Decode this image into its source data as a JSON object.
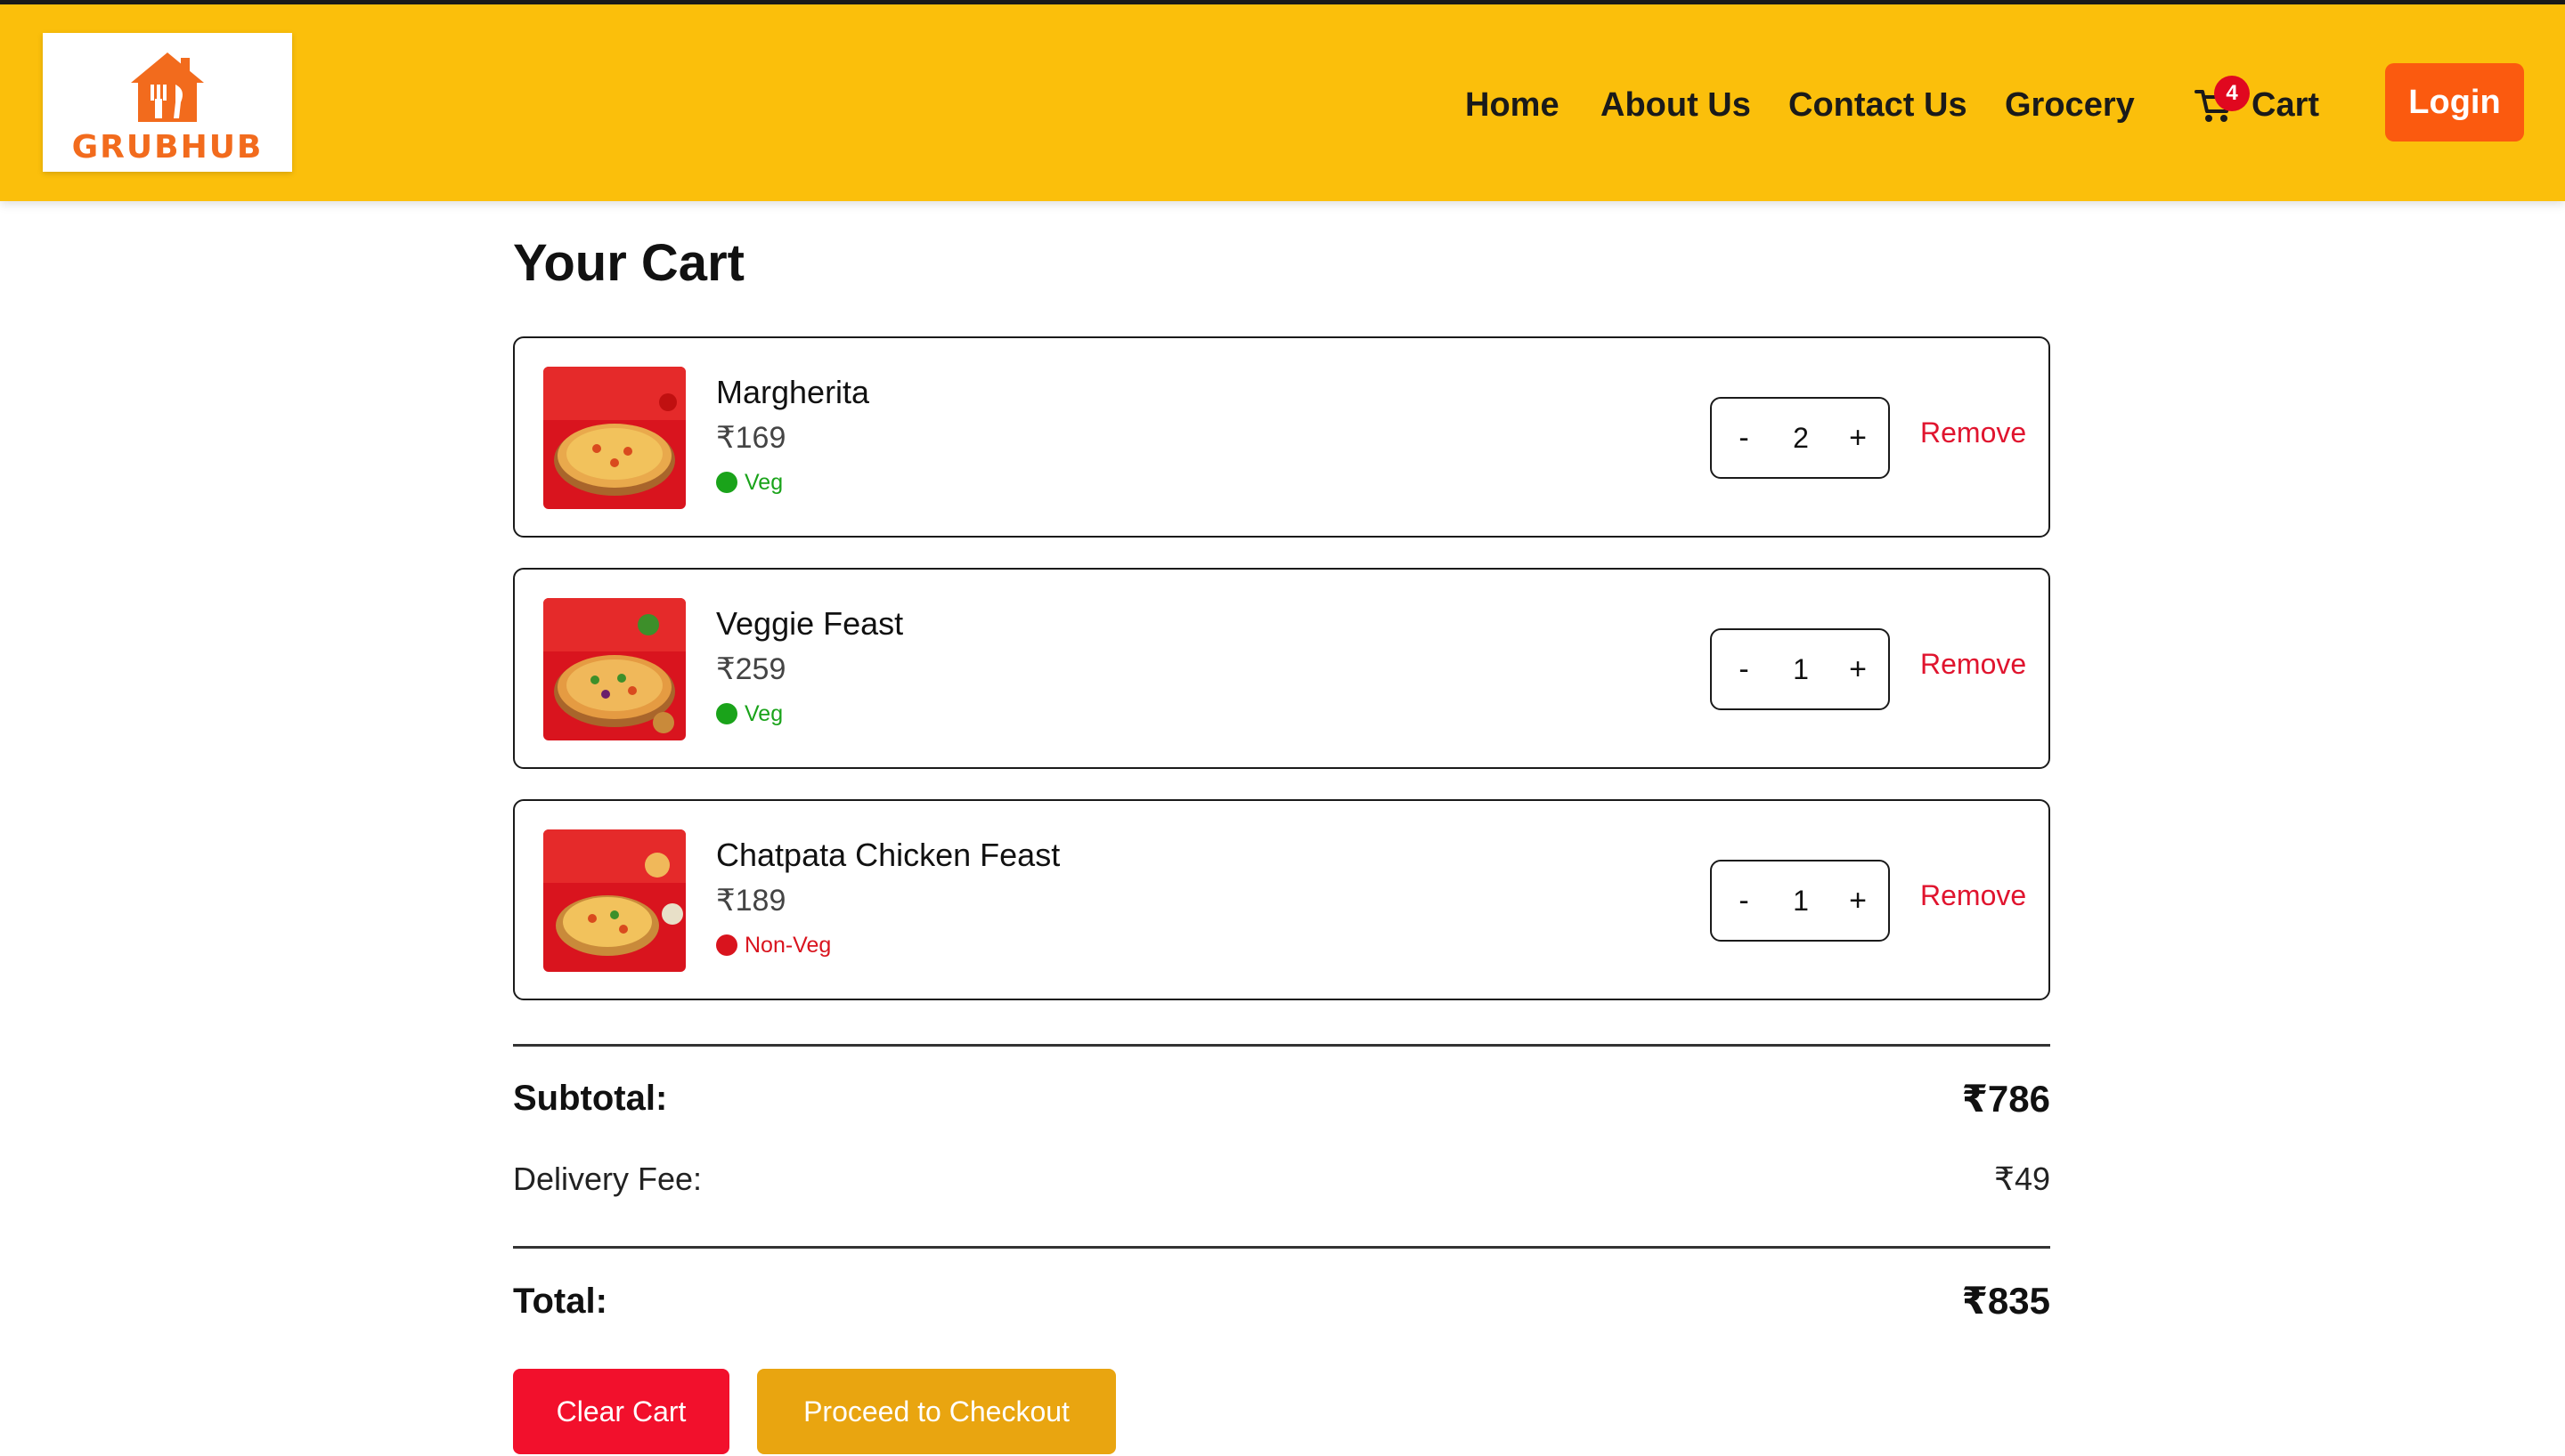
{
  "header": {
    "logo_text": "GRUBHUB",
    "nav": {
      "home": "Home",
      "about": "About Us",
      "contact": "Contact Us",
      "grocery": "Grocery",
      "cart_label": "Cart",
      "cart_count": "4"
    },
    "login_label": "Login"
  },
  "page": {
    "title": "Your Cart"
  },
  "cart": {
    "items": [
      {
        "name": "Margherita",
        "price": "₹169",
        "type": "Veg",
        "quantity": "2",
        "remove_label": "Remove",
        "minus_label": "-",
        "plus_label": "+"
      },
      {
        "name": "Veggie Feast",
        "price": "₹259",
        "type": "Veg",
        "quantity": "1",
        "remove_label": "Remove",
        "minus_label": "-",
        "plus_label": "+"
      },
      {
        "name": "Chatpata Chicken Feast",
        "price": "₹189",
        "type": "Non-Veg",
        "quantity": "1",
        "remove_label": "Remove",
        "minus_label": "-",
        "plus_label": "+"
      }
    ]
  },
  "summary": {
    "subtotal_label": "Subtotal:",
    "subtotal_value": "₹786",
    "delivery_label": "Delivery Fee:",
    "delivery_value": "₹49",
    "total_label": "Total:",
    "total_value": "₹835"
  },
  "actions": {
    "clear_label": "Clear Cart",
    "checkout_label": "Proceed to Checkout"
  },
  "colors": {
    "header_bg": "#fbbf0b",
    "login_bg": "#fb5a0f",
    "veg": "#1aa31a",
    "non_veg": "#d9141e",
    "remove": "#e0142e",
    "clear_bg": "#f2102c",
    "checkout_bg": "#e9a510",
    "brand": "#f26b1d"
  },
  "icons": {
    "logo": "grubhub-house-fork-knife-icon",
    "cart": "shopping-cart-icon",
    "veg": "green-dot-icon",
    "non_veg": "red-dot-icon"
  }
}
